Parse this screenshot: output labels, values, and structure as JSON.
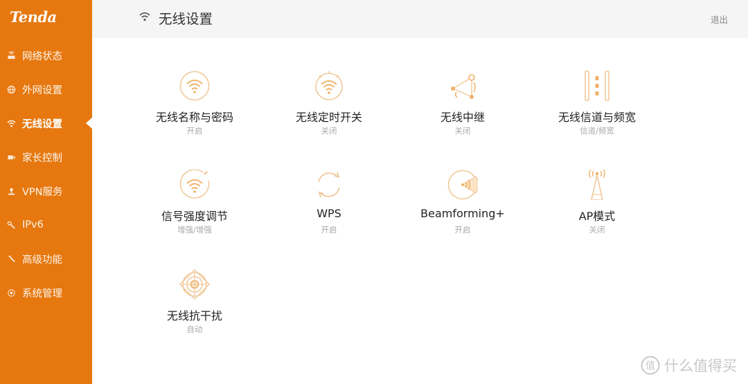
{
  "brand": {
    "logo_text": "Tenda",
    "accent_color": "#e6780f"
  },
  "sidebar": {
    "items": [
      {
        "label": "网络状态",
        "icon": "router-icon"
      },
      {
        "label": "外网设置",
        "icon": "globe-icon"
      },
      {
        "label": "无线设置",
        "icon": "wifi-icon",
        "active": true
      },
      {
        "label": "家长控制",
        "icon": "parental-control-icon"
      },
      {
        "label": "VPN服务",
        "icon": "vpn-icon"
      },
      {
        "label": "IPv6",
        "icon": "wrench-icon"
      },
      {
        "label": "高级功能",
        "icon": "tools-icon"
      },
      {
        "label": "系统管理",
        "icon": "gear-icon"
      }
    ]
  },
  "header": {
    "title": "无线设置",
    "logout_label": "退出"
  },
  "tiles": [
    {
      "title": "无线名称与密码",
      "status": "开启",
      "icon": "wifi-circle-icon"
    },
    {
      "title": "无线定时开关",
      "status": "关闭",
      "icon": "wifi-timer-icon"
    },
    {
      "title": "无线中继",
      "status": "关闭",
      "icon": "repeater-icon"
    },
    {
      "title": "无线信道与频宽",
      "status": "信道/频宽",
      "icon": "channel-icon"
    },
    {
      "title": "信号强度调节",
      "status": "增强/增强",
      "icon": "signal-strength-icon"
    },
    {
      "title": "WPS",
      "status": "开启",
      "icon": "wps-icon"
    },
    {
      "title": "Beamforming+",
      "status": "开启",
      "icon": "beamforming-icon"
    },
    {
      "title": "AP模式",
      "status": "关闭",
      "icon": "antenna-icon"
    },
    {
      "title": "无线抗干扰",
      "status": "自动",
      "icon": "anti-interference-icon"
    }
  ],
  "watermark": {
    "text": "什么值得买"
  }
}
